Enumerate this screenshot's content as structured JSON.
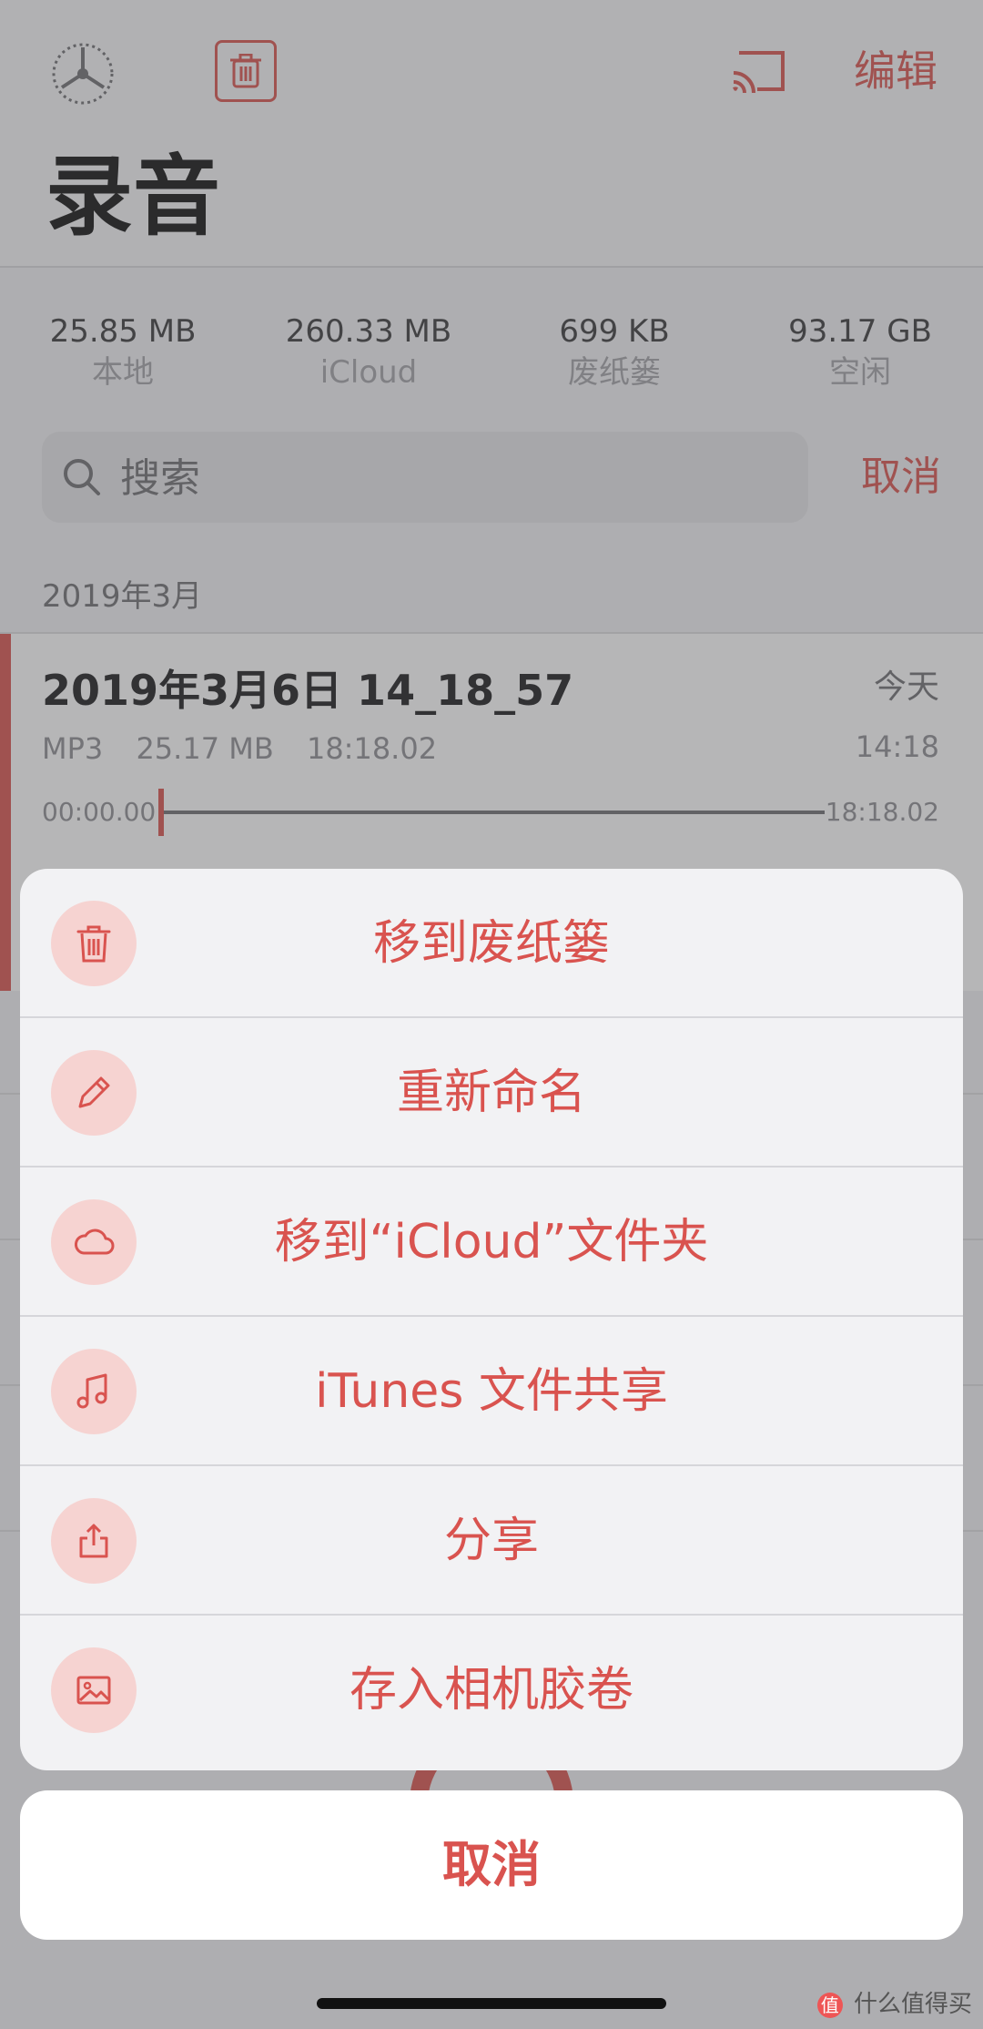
{
  "nav": {
    "clock_icon": "speed-dial-icon",
    "trash_icon": "trash-icon",
    "cast_icon": "airplay-cast-icon",
    "edit_label": "编辑",
    "title": "录音"
  },
  "stats": [
    {
      "value": "25.85 MB",
      "label": "本地"
    },
    {
      "value": "260.33 MB",
      "label": "iCloud"
    },
    {
      "value": "699 KB",
      "label": "废纸篓"
    },
    {
      "value": "93.17 GB",
      "label": "空闲"
    }
  ],
  "search": {
    "placeholder": "搜索",
    "cancel_label": "取消"
  },
  "section": {
    "header": "2019年3月"
  },
  "recording": {
    "title": "2019年3月6日 14_18_57",
    "date": "今天",
    "time": "14:18",
    "format": "MP3",
    "size": "25.17 MB",
    "duration": "18:18.02",
    "position_start": "00:00.00",
    "position_end": "18:18.02",
    "playback_progress": 0.0
  },
  "action_sheet": {
    "items": [
      {
        "label": "移到废纸篓",
        "icon": "trash-icon"
      },
      {
        "label": "重新命名",
        "icon": "pencil-icon"
      },
      {
        "label": "移到“iCloud”文件夹",
        "icon": "cloud-icon"
      },
      {
        "label": "iTunes 文件共享",
        "icon": "music-note-icon"
      },
      {
        "label": "分享",
        "icon": "share-icon"
      },
      {
        "label": "存入相机胶卷",
        "icon": "photo-icon"
      }
    ],
    "cancel_label": "取消"
  },
  "watermark": {
    "badge": "值",
    "text": "什么值得买"
  },
  "colors": {
    "accent": "#d9534f",
    "icon_bg": "#f6d3d1"
  }
}
